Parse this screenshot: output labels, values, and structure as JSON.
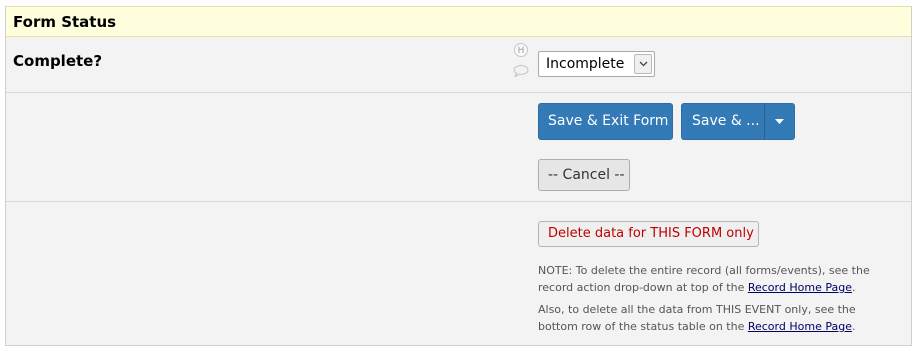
{
  "form_status": {
    "header": "Form Status",
    "complete_label": "Complete?",
    "history_icon_text": "H",
    "status_select": {
      "value": "Incomplete"
    }
  },
  "actions": {
    "save_exit_label": "Save & Exit Form",
    "save_more_label": "Save & ...",
    "cancel_label": "-- Cancel --",
    "delete_label": "Delete data for THIS FORM only"
  },
  "notes": {
    "note1_text": "NOTE: To delete the entire record (all forms/events), see the record action drop-down at top of the ",
    "note1_link": "Record Home Page",
    "note1_end": ".",
    "note2_text": "Also, to delete all the data from THIS EVENT only, see the bottom row of the status table on the ",
    "note2_link": "Record Home Page",
    "note2_end": "."
  },
  "colors": {
    "header_bg": "#fffedd",
    "primary_button": "#337ab7",
    "delete_text": "#c00000"
  }
}
